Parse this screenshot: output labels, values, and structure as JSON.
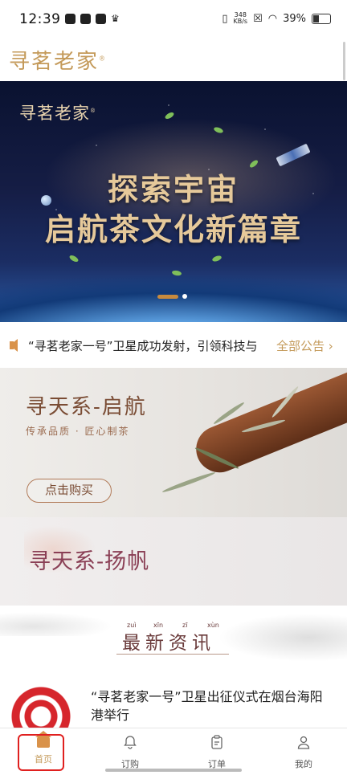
{
  "status_bar": {
    "time": "12:39",
    "net_speed_top": "348",
    "net_speed_unit": "KB/s",
    "battery": "39%"
  },
  "header": {
    "logo": "寻茗老家",
    "logo_mark": "®"
  },
  "banner": {
    "brand": "寻茗老家",
    "brand_mark": "®",
    "line1": "探索宇宙",
    "line2": "启航茶文化新篇章",
    "page_count": 2,
    "active_index": 0
  },
  "notice": {
    "text": "“寻茗老家一号”卫星成功发射，引领科技与",
    "all_label": "全部公告 ",
    "chevron": "›"
  },
  "promo1": {
    "title": "寻天系-启航",
    "subtitle": "传承品质 · 匠心制茶",
    "button": "点击购买"
  },
  "promo2": {
    "title": "寻天系-扬帆"
  },
  "news_section": {
    "title": "最新资讯",
    "pinyin": [
      "zuì",
      "xīn",
      "zī",
      "xùn"
    ]
  },
  "news": [
    {
      "title": "“寻茗老家一号”卫星出征仪式在烟台海阳港举行"
    }
  ],
  "tabbar": {
    "items": [
      {
        "label": "首页",
        "icon": "home-icon"
      },
      {
        "label": "订购",
        "icon": "bell-icon"
      },
      {
        "label": "订单",
        "icon": "clipboard-icon"
      },
      {
        "label": "我的",
        "icon": "person-icon"
      }
    ],
    "active_index": 0
  },
  "colors": {
    "accent": "#c49a5a",
    "highlight_border": "#e0201f",
    "promo2_title": "#8a3f55"
  }
}
